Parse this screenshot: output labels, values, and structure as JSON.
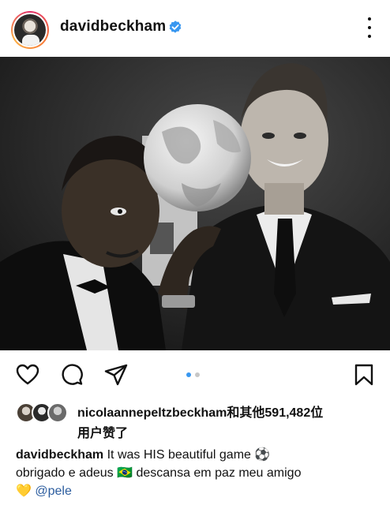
{
  "header": {
    "username": "davidbeckham",
    "verified": true,
    "more_icon": "more-vertical-icon"
  },
  "post": {
    "image_alt": "Black and white photo of two men in tuxedos with a soccer ball",
    "carousel": {
      "total": 2,
      "current": 1
    }
  },
  "actions": {
    "like_icon": "heart-icon",
    "comment_icon": "comment-icon",
    "share_icon": "send-icon",
    "save_icon": "bookmark-icon"
  },
  "likes": {
    "text_line1": "nicolaannepeltzbeckham和其他591,482位",
    "text_line2": "用户赞了"
  },
  "caption": {
    "username": "davidbeckham",
    "text_1": " It was HIS beautiful game ⚽",
    "text_2": "obrigado e adeus 🇧🇷 descansa em paz meu amigo",
    "text_3": "💛 ",
    "mention": "@pele"
  },
  "colors": {
    "accent": "#3897f0",
    "verified": "#3897f0",
    "mention": "#2b5c9e"
  }
}
